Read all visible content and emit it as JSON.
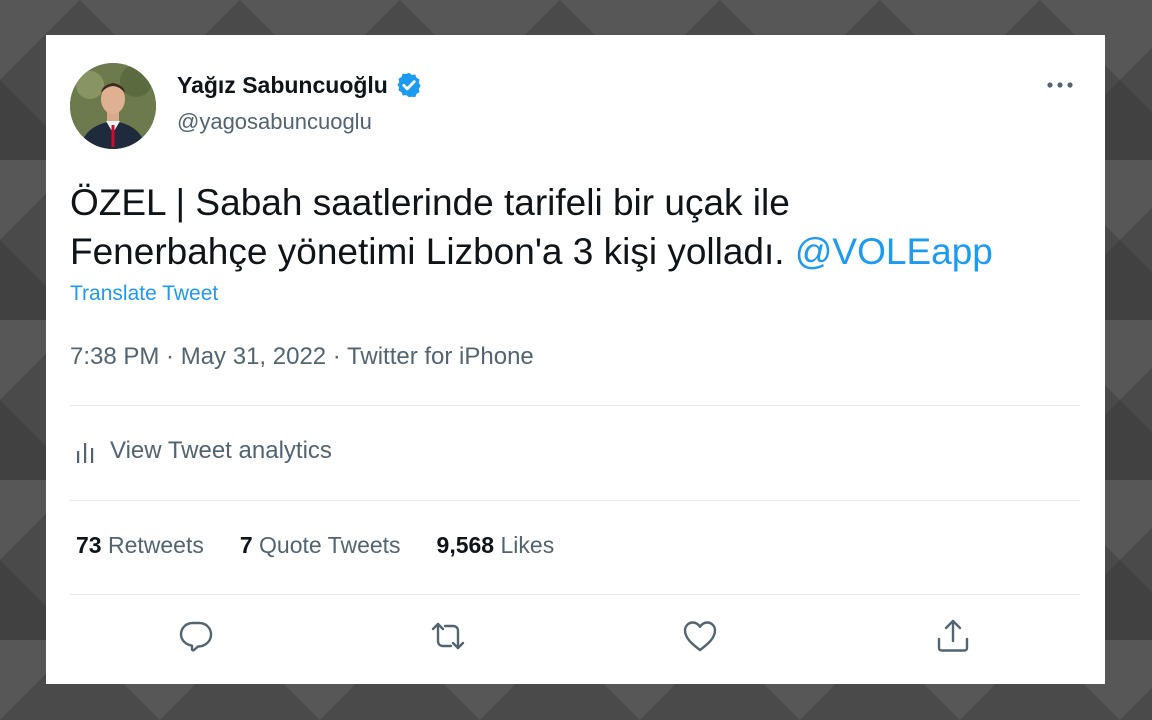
{
  "author": {
    "name": "Yağız Sabuncuoğlu",
    "handle": "@yagosabuncuoglu",
    "verified": true
  },
  "tweet": {
    "text_line1": "ÖZEL | Sabah saatlerinde tarifeli bir uçak ile",
    "text_line2": "Fenerbahçe yönetimi Lizbon'a 3 kişi yolladı.",
    "mention": "@VOLEapp",
    "translate_label": "Translate Tweet",
    "meta": "7:38 PM · May 31, 2022 · Twitter for iPhone"
  },
  "analytics": {
    "label": "View Tweet analytics"
  },
  "stats": [
    {
      "count": "73",
      "label": "Retweets"
    },
    {
      "count": "7",
      "label": "Quote Tweets"
    },
    {
      "count": "9,568",
      "label": "Likes"
    }
  ],
  "actions": [
    "reply-icon",
    "retweet-icon",
    "like-icon",
    "share-icon"
  ],
  "colors": {
    "accent": "#1d9bf0",
    "text": "#0f1419",
    "muted": "#536471"
  }
}
